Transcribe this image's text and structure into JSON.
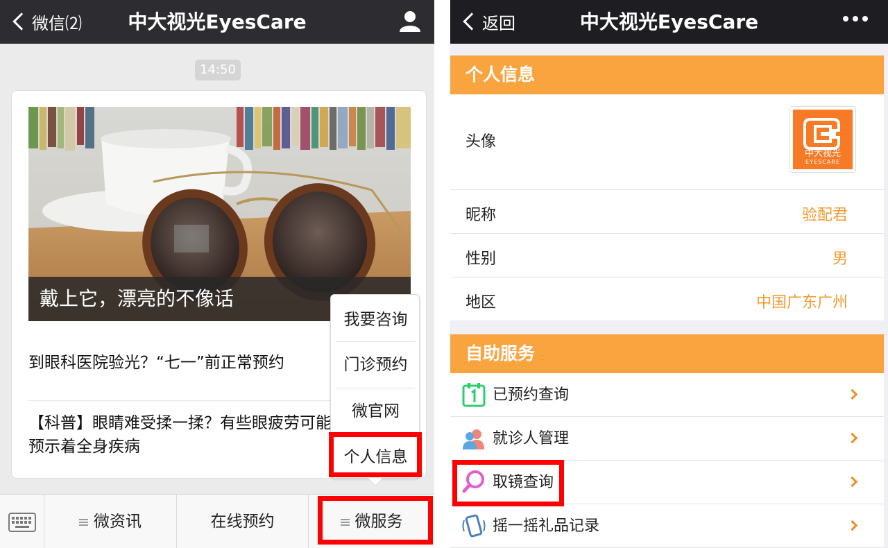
{
  "left": {
    "nav": {
      "back_label": "微信⑵",
      "title": "中大视光EyesCare"
    },
    "time": "14:50",
    "hero_caption": "戴上它，漂亮的不像话",
    "articles": [
      "到眼科医院验光？“七一”前正常预约",
      "【科普】眼睛难受揉一揉？有些眼疲劳可能预示着全身疾病"
    ],
    "popup_menu": [
      "我要咨询",
      "门诊预约",
      "微官网",
      "个人信息"
    ],
    "tabs": [
      "微资讯",
      "在线预约",
      "微服务"
    ]
  },
  "right": {
    "nav": {
      "back_label": "返回",
      "title": "中大视光EyesCare"
    },
    "personal": {
      "header": "个人信息",
      "avatar_label": "头像",
      "avatar_logo_cn": "中大视光",
      "avatar_logo_en": "EYESCARE",
      "nickname_label": "昵称",
      "nickname": "验配君",
      "gender_label": "性别",
      "gender": "男",
      "region_label": "地区",
      "region": "中国广东广州"
    },
    "services": {
      "header": "自助服务",
      "items": [
        "已预约查询",
        "就诊人管理",
        "取镜查询",
        "摇一摇礼品记录"
      ]
    }
  },
  "colors": {
    "accent_orange": "#f9a43f",
    "value_orange": "#f29a33",
    "highlight_red": "#ff0000",
    "navbar": "#2d2c31"
  }
}
